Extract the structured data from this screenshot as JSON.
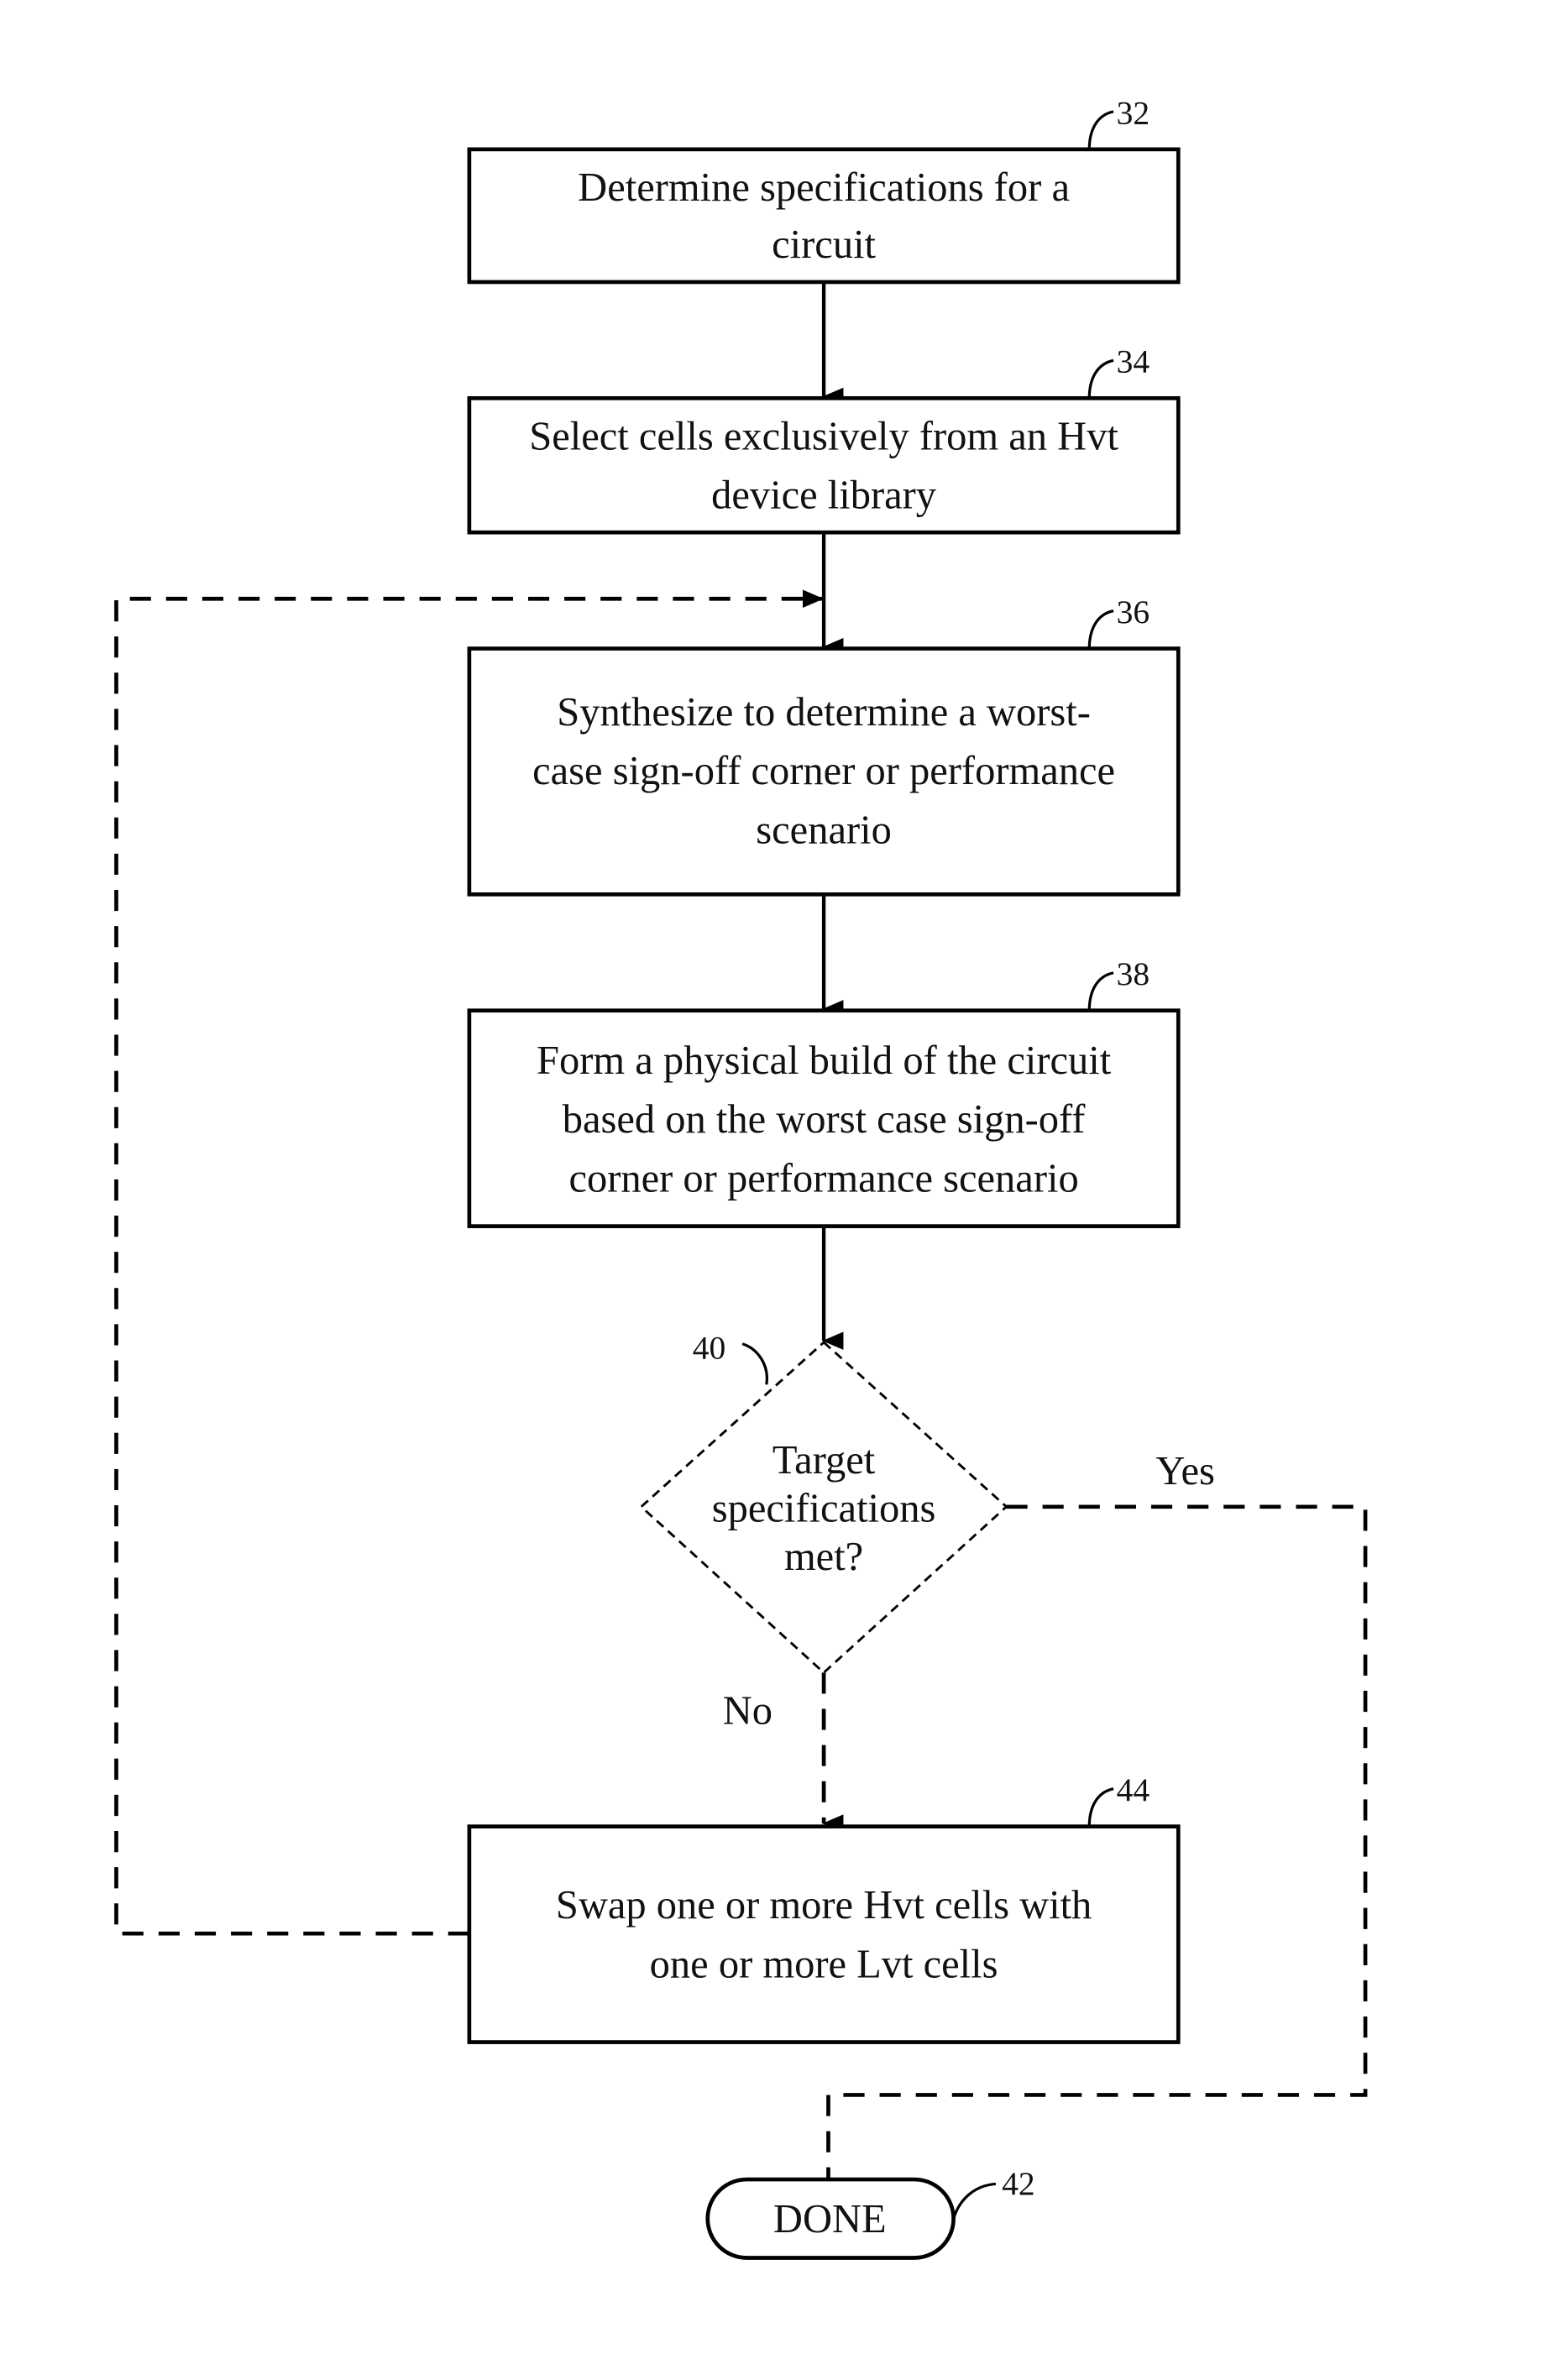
{
  "figure": {
    "steps": [
      {
        "ref": "32",
        "lines": [
          "Determine specifications for a",
          "circuit"
        ]
      },
      {
        "ref": "34",
        "lines": [
          "Select cells exclusively from an Hvt",
          "device library"
        ]
      },
      {
        "ref": "36",
        "lines": [
          "Synthesize to determine a worst-",
          "case sign-off corner or performance",
          "scenario"
        ]
      },
      {
        "ref": "38",
        "lines": [
          "Form a physical build of the circuit",
          "based on the worst case sign-off",
          "corner or performance scenario"
        ]
      },
      {
        "ref": "44",
        "lines": [
          "Swap one or more Hvt cells with",
          "one or more Lvt cells"
        ]
      }
    ],
    "decision": {
      "ref": "40",
      "lines": [
        "Target",
        "specifications",
        "met?"
      ],
      "yes_label": "Yes",
      "no_label": "No"
    },
    "terminal": {
      "ref": "42",
      "label": "DONE"
    }
  }
}
